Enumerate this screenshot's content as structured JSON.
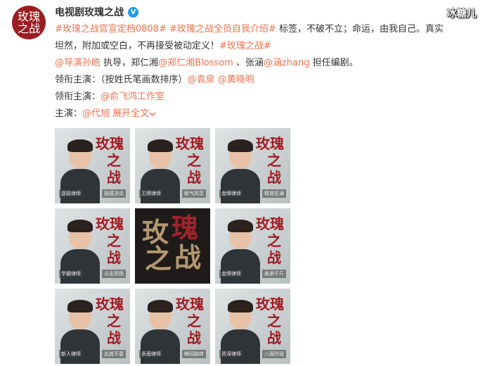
{
  "account": {
    "avatar_line1": "玫瑰",
    "avatar_line2": "之战",
    "name": "电视剧玫瑰之战",
    "verified_mark": "V"
  },
  "watermark": "冰糖儿",
  "post": {
    "line1": {
      "tag1": "#玫瑰之战官宣定档0808#",
      "tag2": "#玫瑰之战全员自我介绍#",
      "text": "标签，不破不立；命运，由我自己。真实"
    },
    "line2": {
      "text": "坦然，附加或空白，不再接受被动定义！",
      "tag": "#玫瑰之战#"
    },
    "line3": {
      "mention1": "@导演孙皓",
      "text1": "执导，郑仁湘",
      "mention2": "@郑仁湘Blossom",
      "text2": "、张涵",
      "mention3": "@涵zhang",
      "text3": "担任编剧。"
    },
    "line4": {
      "text": "领衔主演：（按姓氏笔画数排序）",
      "mention1": "@袁泉",
      "mention2": "@黄晓明"
    },
    "line5": {
      "text": "领衔主演：",
      "mention": "@俞飞鸿工作室"
    },
    "line6": {
      "text": "主演：",
      "mention": "@代旭",
      "expand": "展开全文",
      "chevron": "chevron-down-icon"
    }
  },
  "images": [
    {
      "char1": "玫",
      "char2": "瑰",
      "char3": "之",
      "char4": "战",
      "badge_left": "逐路律师",
      "badge_right": "独孤决论"
    },
    {
      "char1": "玫",
      "char2": "瑰",
      "char3": "之",
      "char4": "战",
      "badge_left": "王牌律师",
      "badge_right": "新气风范"
    },
    {
      "char1": "玫",
      "char2": "瑰",
      "char3": "之",
      "char4": "战",
      "badge_left": "金牌律师",
      "badge_right": "精准狂澜"
    },
    {
      "char1": "玫",
      "char2": "瑰",
      "char3": "之",
      "char4": "战",
      "badge_left": "学霸律师",
      "badge_right": "斗志昂扬"
    },
    {
      "big1": "玫",
      "big2": "瑰",
      "big3": "之",
      "big4": "战"
    },
    {
      "char1": "玫",
      "char2": "瑰",
      "char3": "之",
      "char4": "战",
      "badge_left": "金牌律师",
      "badge_right": "肩承千斤"
    },
    {
      "char1": "玫",
      "char2": "瑰",
      "char3": "之",
      "char4": "战",
      "badge_left": "新人律师",
      "badge_right": "出其不意"
    },
    {
      "char1": "玫",
      "char2": "瑰",
      "char3": "之",
      "char4": "战",
      "badge_left": "多面律师",
      "badge_right": "峰回路转"
    },
    {
      "char1": "玫",
      "char2": "瑰",
      "char3": "之",
      "char4": "战",
      "badge_left": "资深律师",
      "badge_right": "八面玲珑"
    }
  ],
  "colors": {
    "link": "#eb7350",
    "accent_red": "#a11c22",
    "verified_blue": "#1d9bf0"
  }
}
